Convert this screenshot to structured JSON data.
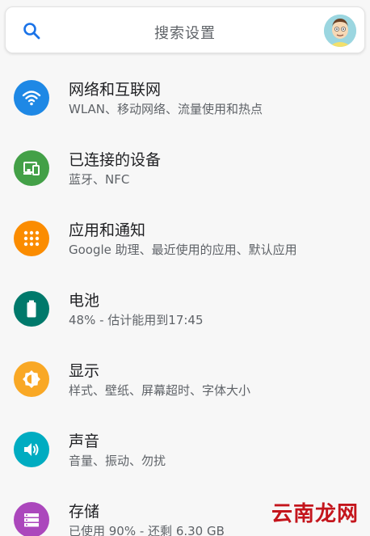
{
  "search": {
    "placeholder": "搜索设置"
  },
  "settings": [
    {
      "id": "network",
      "title": "网络和互联网",
      "subtitle": "WLAN、移动网络、流量使用和热点",
      "icon": "wifi-icon",
      "color": "#1E88E5"
    },
    {
      "id": "connected-devices",
      "title": "已连接的设备",
      "subtitle": "蓝牙、NFC",
      "icon": "devices-icon",
      "color": "#43A047"
    },
    {
      "id": "apps",
      "title": "应用和通知",
      "subtitle": "Google 助理、最近使用的应用、默认应用",
      "icon": "apps-grid-icon",
      "color": "#FB8C00"
    },
    {
      "id": "battery",
      "title": "电池",
      "subtitle": "48% - 估计能用到17:45",
      "icon": "battery-icon",
      "color": "#00796B",
      "level_percent": 48
    },
    {
      "id": "display",
      "title": "显示",
      "subtitle": "样式、壁纸、屏幕超时、字体大小",
      "icon": "brightness-icon",
      "color": "#F9A825"
    },
    {
      "id": "sound",
      "title": "声音",
      "subtitle": "音量、振动、勿扰",
      "icon": "volume-icon",
      "color": "#00ACC1"
    },
    {
      "id": "storage",
      "title": "存储",
      "subtitle": "已使用 90% - 还剩 6.30 GB",
      "icon": "storage-icon",
      "color": "#AB47BC"
    }
  ],
  "watermark": {
    "text": "云南龙网"
  }
}
